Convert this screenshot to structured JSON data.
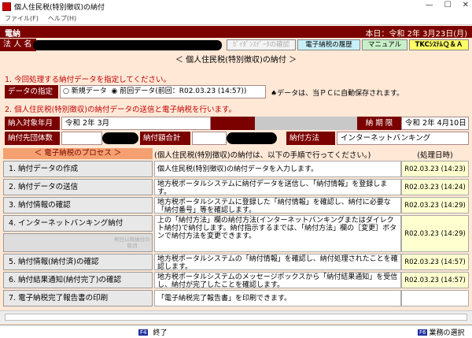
{
  "window": {
    "title": "個人住民税(特別徴収)の納付"
  },
  "menu": [
    "ファイル(F)",
    "ヘルプ(H)"
  ],
  "header": {
    "left": "電納",
    "right": "本日：令和 2年 3月23日(月)"
  },
  "hojin_label": "法 人 名",
  "toolbar": {
    "b1": "ｶﾞｲﾀﾞﾝｽﾃﾞｰﾀの確認",
    "b2": "電子納税の履歴",
    "b3": "マニュアル",
    "b4": "TKCｼｽﾃﾑＱ＆Ａ"
  },
  "section_title": "＜ 個人住民税(特別徴収)の納付 ＞",
  "step1": "1. 今回処理する納付データを指定してください。",
  "spec_label": "データの指定",
  "radio_new": "新規データ",
  "radio_prev": "前回データ(前回：R02.03.23 (14:57))",
  "save_note": "♠データは、当ＰＣに自動保存されます。",
  "step2": "2. 個人住民税(特別徴収)の納付データの送信と電子納税を行います。",
  "fields": {
    "period_label": "納入対象年月",
    "period_value": "令和 2年 3月",
    "deadline_label": "納 期 限",
    "deadline_value": "令和 2年 4月10日",
    "dest_label": "納付先団体数",
    "total_label": "納付額合計",
    "method_label": "納付方法",
    "method_value": "インターネットバンキング"
  },
  "process_header": "＜ 電子納税のプロセス ＞",
  "desc_header": "(個人住民税(特別徴収)の納付は、以下の手順で行ってください。)",
  "date_header": "(処理日時)",
  "steps": [
    {
      "label": "1. 納付データの作成",
      "desc": "個人住民税(特別徴収)の納付データを入力します。",
      "date": "R02.03.23 (14:23)"
    },
    {
      "label": "2. 納付データの送信",
      "desc": "地方税ポータルシステムに納付データを送信し、「納付情報」を登録します。",
      "date": "R02.03.23 (14:24)"
    },
    {
      "label": "3. 納付情報の確認",
      "desc": "地方税ポータルシステムに登録した「納付情報」を確認し、納付に必要な「納付番号」等を確認します。",
      "date": "R02.03.23 (14:29)"
    },
    {
      "label": "4. インターネットバンキング納付",
      "desc": "上の「納付方法」欄の納付方法(インターネットバンキングまたはダイレクト納付)で納付します。納付指示するまでは、「納付方法」欄の［変更］ボタンで納付方法を変更できます。",
      "date": "R02.03.23 (14:29)",
      "sub": "明日以降納付の取消"
    },
    {
      "label": "5. 納付情報(納付済)の確認",
      "desc": "地方税ポータルシステムの「納付情報」を確認し、納付処理されたことを確認します。",
      "date": "R02.03.23 (14:57)"
    },
    {
      "label": "6. 納付結果通知(納付完了)の確認",
      "desc": "地方税ポータルシステムのメッセージボックスから「納付結果通知」を受信し、納付が完了したことを確認します。",
      "date": "R02.03.23 (14:57)"
    },
    {
      "label": "7. 電子納税完了報告書の印刷",
      "desc": "「電子納税完了報告書」を印刷できます。",
      "date": ""
    }
  ],
  "footer": {
    "f4": "F4",
    "end": "終了",
    "f6": "F6",
    "select": "業務の選択"
  }
}
